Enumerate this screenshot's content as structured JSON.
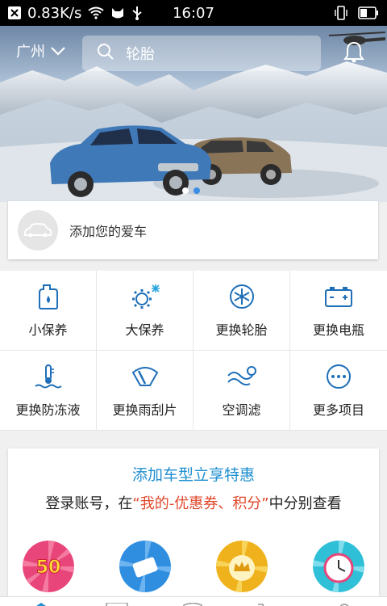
{
  "status_bar": {
    "net_speed": "0.83K/s",
    "time": "16:07"
  },
  "header": {
    "city": "广州",
    "search_placeholder": "轮胎"
  },
  "add_car": {
    "label": "添加您的爱车"
  },
  "services": [
    {
      "label": "小保养",
      "icon": "oil-bottle-icon"
    },
    {
      "label": "大保养",
      "icon": "gear-icon"
    },
    {
      "label": "更换轮胎",
      "icon": "tire-icon"
    },
    {
      "label": "更换电瓶",
      "icon": "battery-icon"
    },
    {
      "label": "更换防冻液",
      "icon": "coolant-icon"
    },
    {
      "label": "更换雨刮片",
      "icon": "wiper-icon"
    },
    {
      "label": "空调滤",
      "icon": "ac-filter-icon"
    },
    {
      "label": "更多项目",
      "icon": "more-icon"
    }
  ],
  "promo": {
    "title": "添加车型立享特惠",
    "sub_prefix": "登录账号，在",
    "sub_highlight": "“我的-优惠券、积分”",
    "sub_suffix": "中分别查看",
    "badge_50": "50"
  },
  "colors": {
    "accent": "#1f8fd0",
    "highlight": "#e0472b",
    "icon_blue": "#1e6fb8"
  }
}
